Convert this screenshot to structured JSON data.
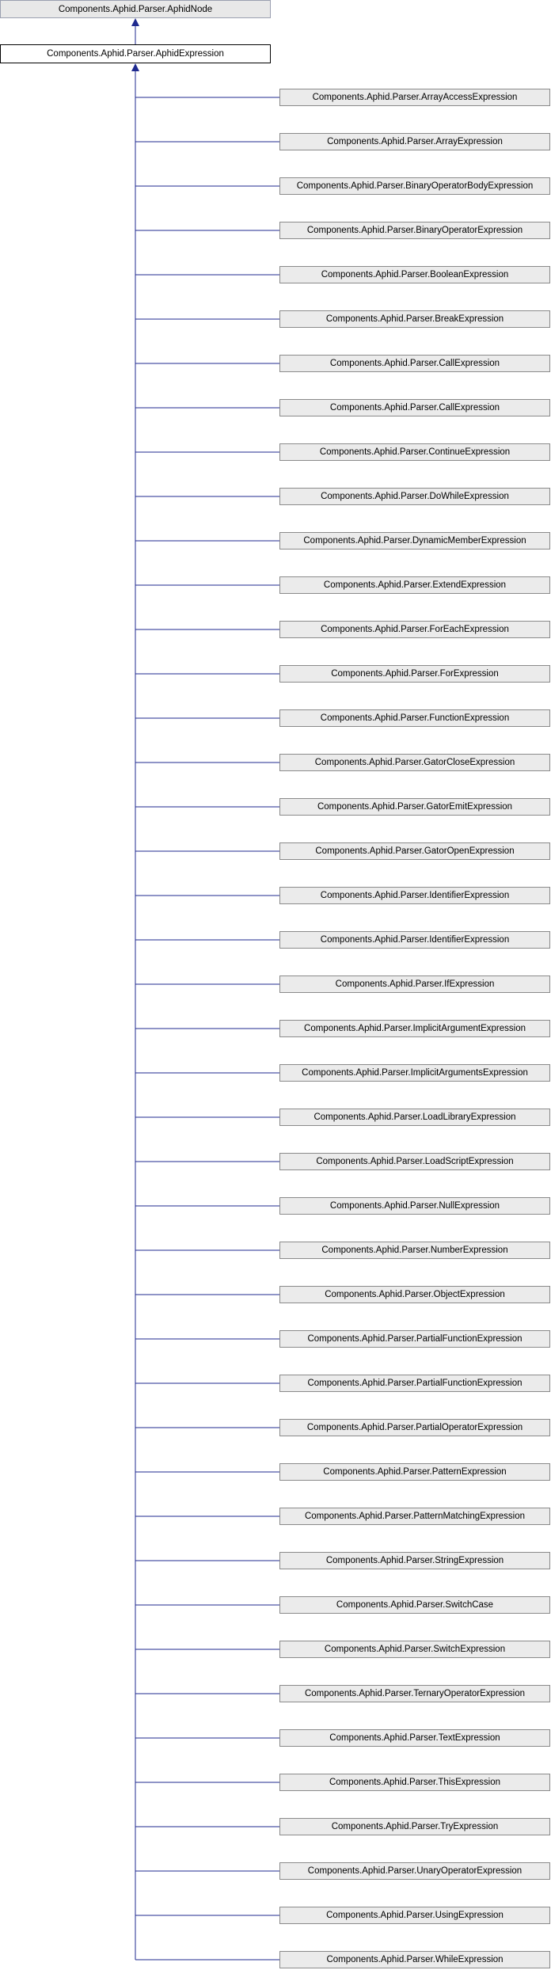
{
  "diagram": {
    "base_class": "Components.Aphid.Parser.AphidNode",
    "self_class": "Components.Aphid.Parser.AphidExpression",
    "derived_classes": [
      "Components.Aphid.Parser.ArrayAccessExpression",
      "Components.Aphid.Parser.ArrayExpression",
      "Components.Aphid.Parser.BinaryOperatorBodyExpression",
      "Components.Aphid.Parser.BinaryOperatorExpression",
      "Components.Aphid.Parser.BooleanExpression",
      "Components.Aphid.Parser.BreakExpression",
      "Components.Aphid.Parser.CallExpression",
      "Components.Aphid.Parser.CallExpression",
      "Components.Aphid.Parser.ContinueExpression",
      "Components.Aphid.Parser.DoWhileExpression",
      "Components.Aphid.Parser.DynamicMemberExpression",
      "Components.Aphid.Parser.ExtendExpression",
      "Components.Aphid.Parser.ForEachExpression",
      "Components.Aphid.Parser.ForExpression",
      "Components.Aphid.Parser.FunctionExpression",
      "Components.Aphid.Parser.GatorCloseExpression",
      "Components.Aphid.Parser.GatorEmitExpression",
      "Components.Aphid.Parser.GatorOpenExpression",
      "Components.Aphid.Parser.IdentifierExpression",
      "Components.Aphid.Parser.IdentifierExpression",
      "Components.Aphid.Parser.IfExpression",
      "Components.Aphid.Parser.ImplicitArgumentExpression",
      "Components.Aphid.Parser.ImplicitArgumentsExpression",
      "Components.Aphid.Parser.LoadLibraryExpression",
      "Components.Aphid.Parser.LoadScriptExpression",
      "Components.Aphid.Parser.NullExpression",
      "Components.Aphid.Parser.NumberExpression",
      "Components.Aphid.Parser.ObjectExpression",
      "Components.Aphid.Parser.PartialFunctionExpression",
      "Components.Aphid.Parser.PartialFunctionExpression",
      "Components.Aphid.Parser.PartialOperatorExpression",
      "Components.Aphid.Parser.PatternExpression",
      "Components.Aphid.Parser.PatternMatchingExpression",
      "Components.Aphid.Parser.StringExpression",
      "Components.Aphid.Parser.SwitchCase",
      "Components.Aphid.Parser.SwitchExpression",
      "Components.Aphid.Parser.TernaryOperatorExpression",
      "Components.Aphid.Parser.TextExpression",
      "Components.Aphid.Parser.ThisExpression",
      "Components.Aphid.Parser.TryExpression",
      "Components.Aphid.Parser.UnaryOperatorExpression",
      "Components.Aphid.Parser.UsingExpression",
      "Components.Aphid.Parser.WhileExpression"
    ],
    "colors": {
      "edge": "#1f2a8f",
      "box_fill": "#ebebeb",
      "box_border": "#8a8a8a",
      "self_fill": "#ffffff",
      "self_border": "#000000"
    }
  }
}
